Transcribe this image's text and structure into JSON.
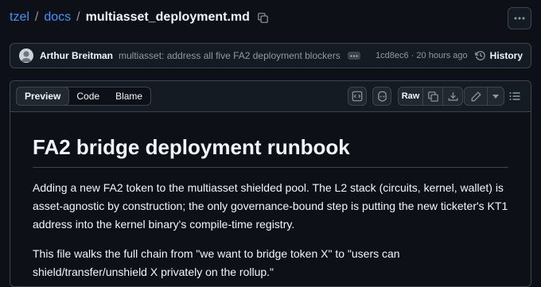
{
  "breadcrumb": {
    "repo": "tzel",
    "sep1": "/",
    "folder": "docs",
    "sep2": "/",
    "file": "multiasset_deployment.md"
  },
  "commit": {
    "author": "Arthur Breitman",
    "message": "multiasset: address all five FA2 deployment blockers",
    "meta": "1cd8ec6 · 20 hours ago",
    "history_label": "History"
  },
  "tabs": {
    "preview": "Preview",
    "code": "Code",
    "blame": "Blame"
  },
  "toolbar": {
    "raw_label": "Raw"
  },
  "document": {
    "title": "FA2 bridge deployment runbook",
    "p1": "Adding a new FA2 token to the multiasset shielded pool. The L2 stack (circuits, kernel, wallet) is asset-agnostic by construction; the only governance-bound step is putting the new ticketer's KT1 address into the kernel binary's compile-time registry.",
    "p2": "This file walks the full chain from \"we want to bridge token X\" to \"users can shield/transfer/unshield X privately on the rollup.\""
  },
  "colors": {
    "link": "#4493f8",
    "background": "#0d1117",
    "border": "#3d444d"
  }
}
